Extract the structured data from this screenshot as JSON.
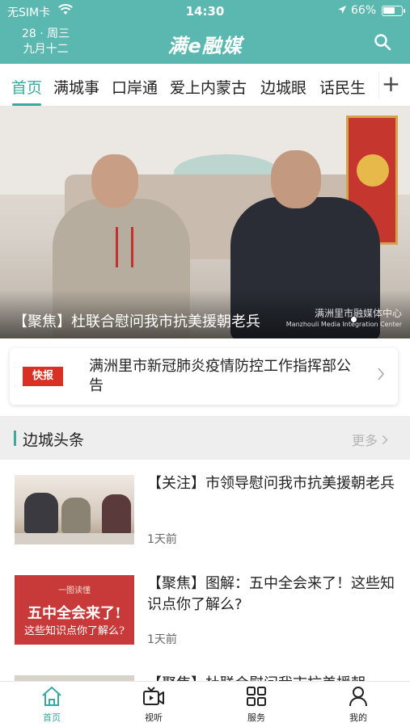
{
  "status_bar": {
    "carrier": "无SIM卡",
    "time": "14:30",
    "battery": "66%",
    "battery_level": 0.66
  },
  "header": {
    "date_line1": "28 · 周三",
    "date_line2": "九月十二",
    "logo": "满e融媒"
  },
  "tabs": [
    {
      "label": "首页",
      "active": true
    },
    {
      "label": "满城事"
    },
    {
      "label": "口岸通"
    },
    {
      "label": "爱上内蒙古"
    },
    {
      "label": "边城眼"
    },
    {
      "label": "话民生"
    }
  ],
  "hero": {
    "caption": "【聚焦】杜联合慰问我市抗美援朝老兵",
    "watermark": "满洲里市融媒体中心",
    "watermark_sub": "Manzhouli Media Integration Center"
  },
  "notice": {
    "badge": "快报",
    "text": "满洲里市新冠肺炎疫情防控工作指挥部公告"
  },
  "section": {
    "title": "边城头条",
    "more": "更多"
  },
  "news": [
    {
      "headline": "【关注】市领导慰问我市抗美援朝老兵",
      "time": "1天前"
    },
    {
      "headline": "【聚焦】图解：五中全会来了！这些知识点你了解么?",
      "time": "1天前",
      "thumb_small": "一图读懂",
      "thumb_big": "五中全会来了!",
      "thumb_mid": "这些知识点你了解么?"
    },
    {
      "headline": "【聚焦】杜联合慰问我市抗美援朝"
    }
  ],
  "bottom_nav": [
    {
      "label": "首页",
      "icon": "home-icon",
      "active": true
    },
    {
      "label": "视听",
      "icon": "video-icon"
    },
    {
      "label": "服务",
      "icon": "grid-icon"
    },
    {
      "label": "我的",
      "icon": "user-icon"
    }
  ],
  "colors": {
    "brand": "#5ab8b0",
    "accent": "#3aa99f",
    "badge": "#d93025"
  }
}
